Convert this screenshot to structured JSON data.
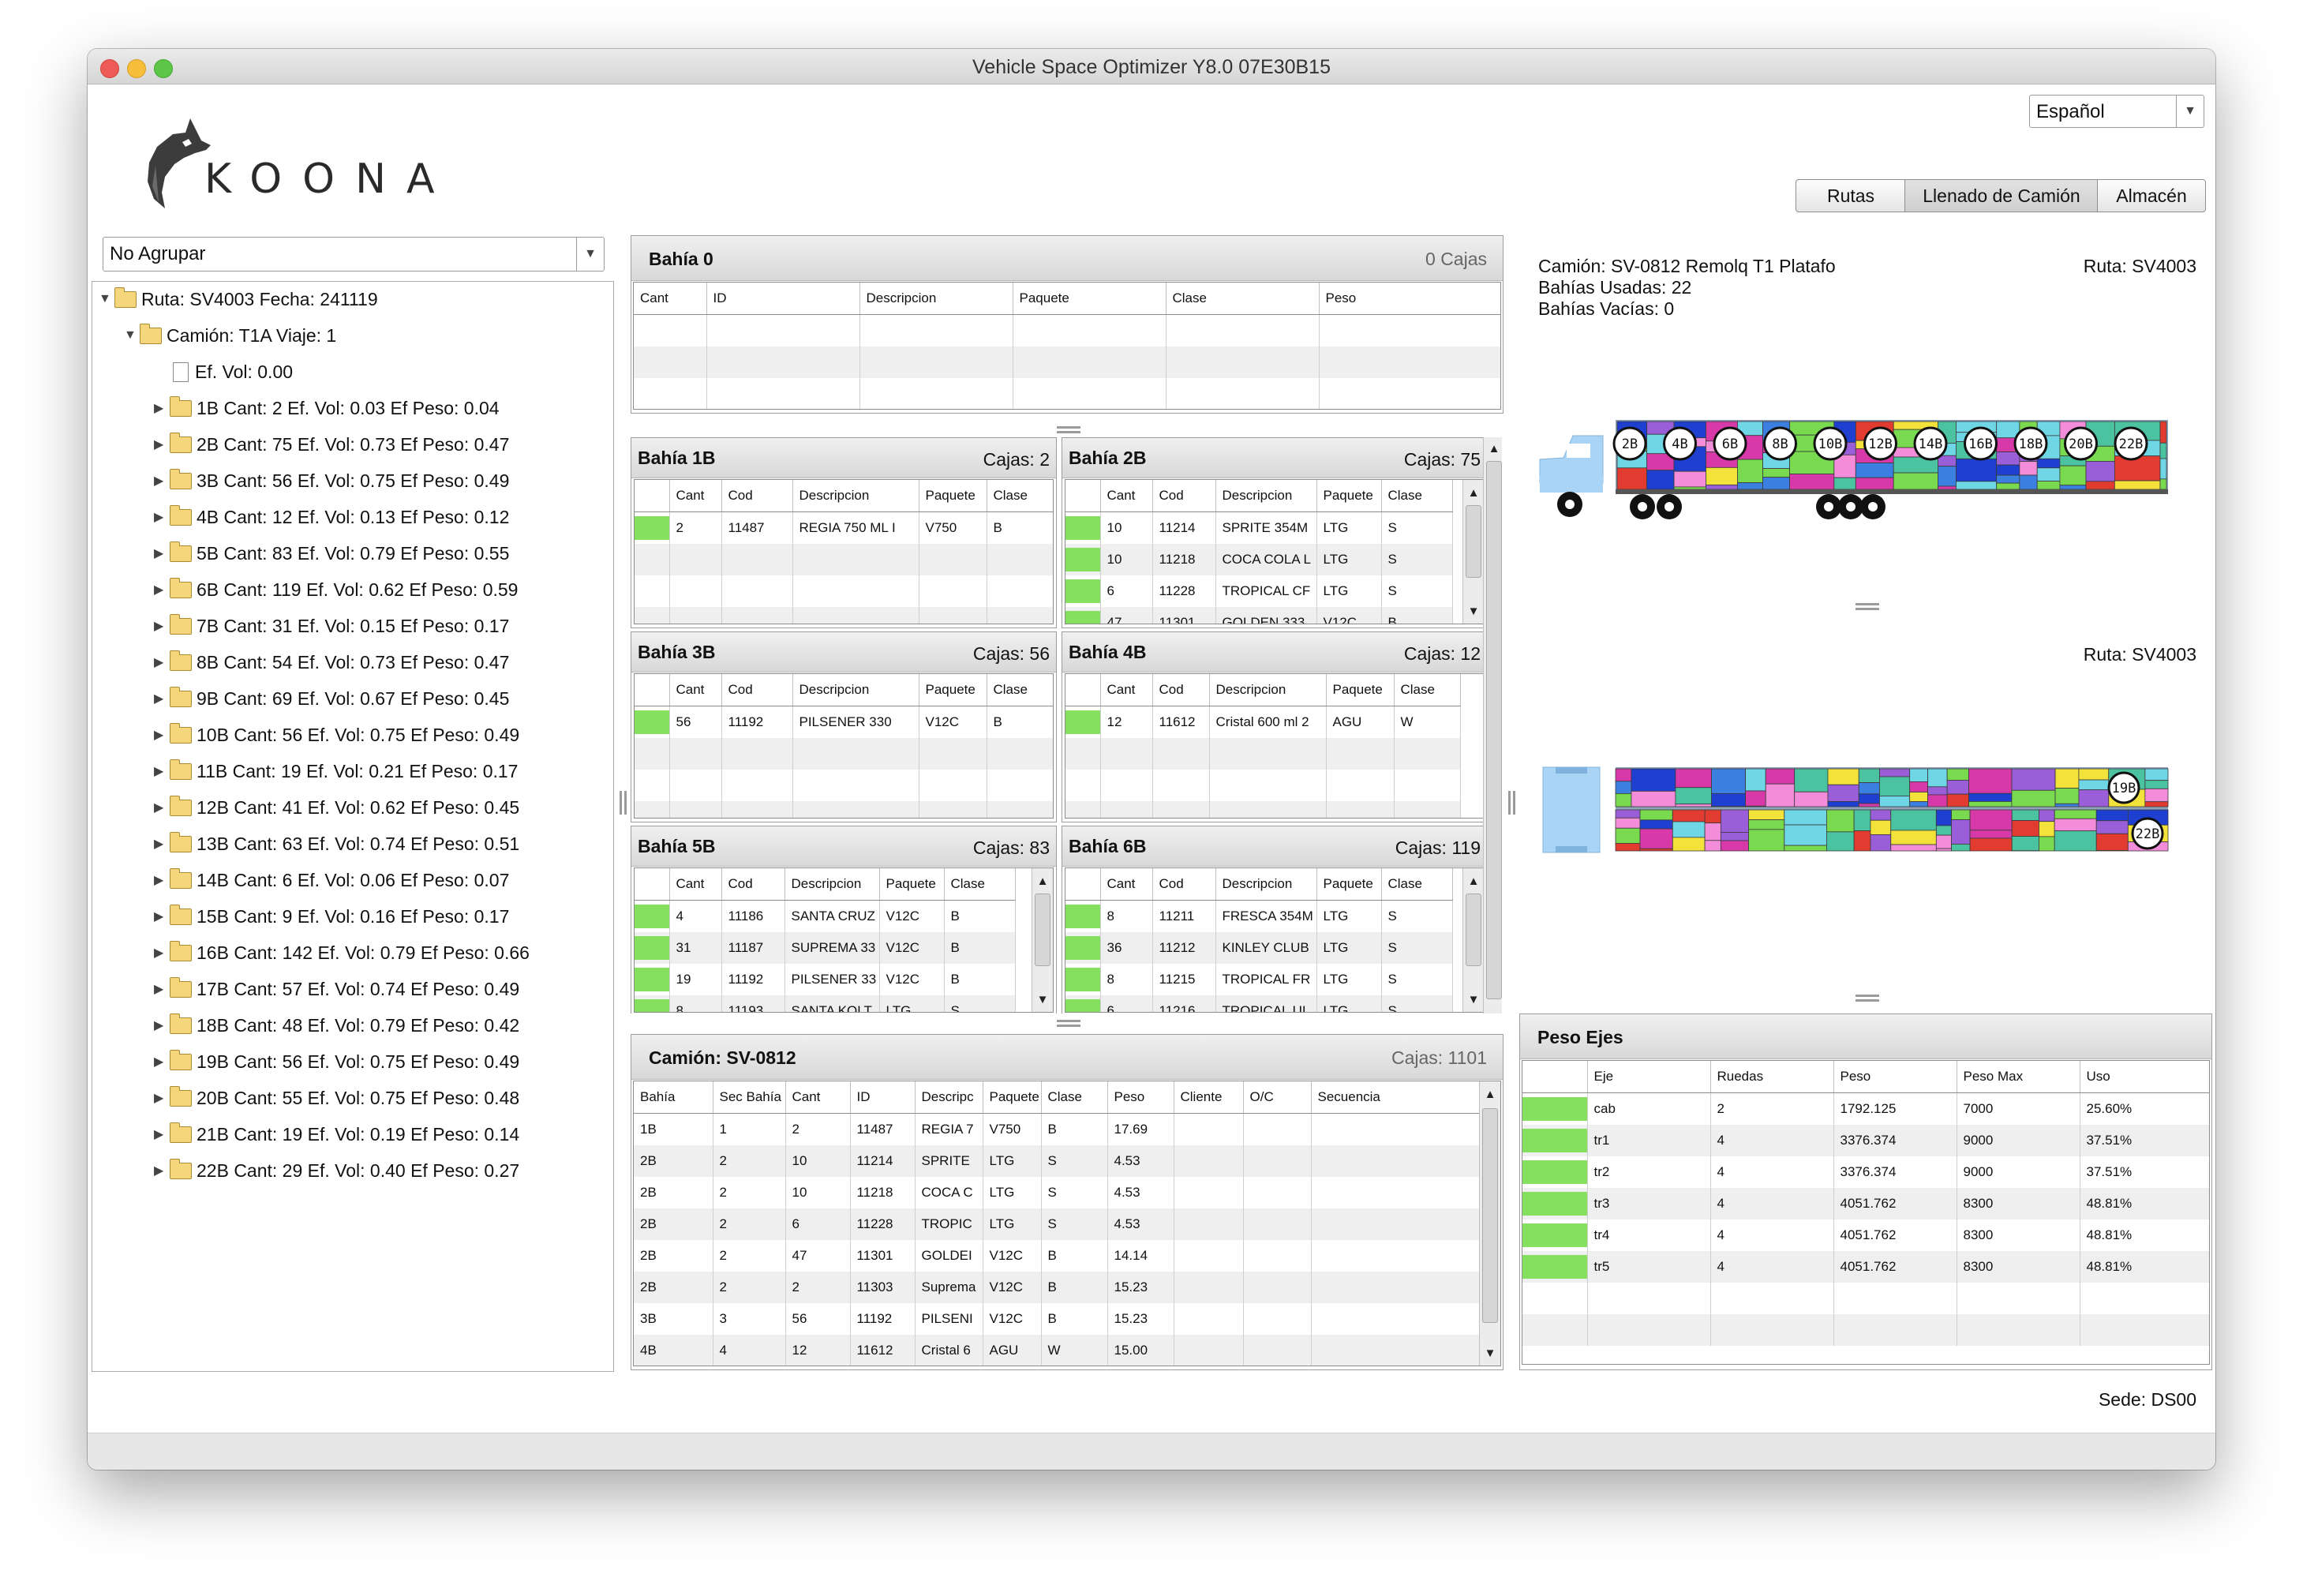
{
  "window": {
    "title": "Vehicle Space Optimizer Y8.0 07E30B15"
  },
  "brand": {
    "logo_text": "KOONA"
  },
  "language": {
    "selected": "Español"
  },
  "nav": {
    "tabs": [
      {
        "label": "Rutas"
      },
      {
        "label": "Llenado de Camión"
      },
      {
        "label": "Almacén"
      }
    ],
    "selected": "Llenado de Camión"
  },
  "grouping": {
    "selected": "No Agrupar"
  },
  "tree": {
    "route": "Ruta: SV4003 Fecha: 241119",
    "truck": "Camión: T1A Viaje: 1",
    "vol": "Ef. Vol: 0.00",
    "bays": [
      "1B Cant: 2 Ef. Vol: 0.03 Ef Peso: 0.04",
      "2B Cant: 75 Ef. Vol: 0.73 Ef Peso: 0.47",
      "3B Cant: 56 Ef. Vol: 0.75 Ef Peso: 0.49",
      "4B Cant: 12 Ef. Vol: 0.13 Ef Peso: 0.12",
      "5B Cant: 83 Ef. Vol: 0.79 Ef Peso: 0.55",
      "6B Cant: 119 Ef. Vol: 0.62 Ef Peso: 0.59",
      "7B Cant: 31 Ef. Vol: 0.15 Ef Peso: 0.17",
      "8B Cant: 54 Ef. Vol: 0.73 Ef Peso: 0.47",
      "9B Cant: 69 Ef. Vol: 0.67 Ef Peso: 0.45",
      "10B Cant: 56 Ef. Vol: 0.75 Ef Peso: 0.49",
      "11B Cant: 19 Ef. Vol: 0.21 Ef Peso: 0.17",
      "12B Cant: 41 Ef. Vol: 0.62 Ef Peso: 0.45",
      "13B Cant: 63 Ef. Vol: 0.74 Ef Peso: 0.51",
      "14B Cant: 6 Ef. Vol: 0.06 Ef Peso: 0.07",
      "15B Cant: 9 Ef. Vol: 0.16 Ef Peso: 0.17",
      "16B Cant: 142 Ef. Vol: 0.79 Ef Peso: 0.66",
      "17B Cant: 57 Ef. Vol: 0.74 Ef Peso: 0.49",
      "18B Cant: 48 Ef. Vol: 0.79 Ef Peso: 0.42",
      "19B Cant: 56 Ef. Vol: 0.75 Ef Peso: 0.49",
      "20B Cant: 55 Ef. Vol: 0.75 Ef Peso: 0.48",
      "21B Cant: 19 Ef. Vol: 0.19 Ef Peso: 0.14",
      "22B Cant: 29 Ef. Vol: 0.40 Ef Peso: 0.27"
    ]
  },
  "bay0": {
    "title": "Bahía 0",
    "count": "0 Cajas",
    "columns": [
      "Cant",
      "ID",
      "Descripcion",
      "Paquete",
      "Clase",
      "Peso"
    ]
  },
  "bay_cols": [
    "",
    "Cant",
    "Cod",
    "Descripcion",
    "Paquete",
    "Clase"
  ],
  "bays": [
    {
      "title": "Bahía 1B",
      "count": "Cajas: 2",
      "rows": [
        [
          "2",
          "11487",
          "REGIA 750 ML I",
          "V750",
          "B"
        ]
      ]
    },
    {
      "title": "Bahía 2B",
      "count": "Cajas: 75",
      "rows": [
        [
          "10",
          "11214",
          "SPRITE 354M",
          "LTG",
          "S"
        ],
        [
          "10",
          "11218",
          "COCA COLA L",
          "LTG",
          "S"
        ],
        [
          "6",
          "11228",
          "TROPICAL CF",
          "LTG",
          "S"
        ],
        [
          "47",
          "11301",
          "GOLDEN 333",
          "V12C",
          "B"
        ]
      ]
    },
    {
      "title": "Bahía 3B",
      "count": "Cajas: 56",
      "rows": [
        [
          "56",
          "11192",
          "PILSENER 330",
          "V12C",
          "B"
        ]
      ]
    },
    {
      "title": "Bahía 4B",
      "count": "Cajas: 12",
      "rows": [
        [
          "12",
          "11612",
          "Cristal 600 ml 2",
          "AGU",
          "W"
        ]
      ]
    },
    {
      "title": "Bahía 5B",
      "count": "Cajas: 83",
      "rows": [
        [
          "4",
          "11186",
          "SANTA CRUZ",
          "V12C",
          "B"
        ],
        [
          "31",
          "11187",
          "SUPREMA 33",
          "V12C",
          "B"
        ],
        [
          "19",
          "11192",
          "PILSENER 33",
          "V12C",
          "B"
        ],
        [
          "8",
          "11193",
          "SANTA KOLT",
          "LTG",
          "S"
        ]
      ]
    },
    {
      "title": "Bahía 6B",
      "count": "Cajas: 119",
      "rows": [
        [
          "8",
          "11211",
          "FRESCA 354M",
          "LTG",
          "S"
        ],
        [
          "36",
          "11212",
          "KINLEY CLUB",
          "LTG",
          "S"
        ],
        [
          "8",
          "11215",
          "TROPICAL FR",
          "LTG",
          "S"
        ],
        [
          "6",
          "11216",
          "TROPICAL UI",
          "LTG",
          "S"
        ]
      ]
    }
  ],
  "truck_panel": {
    "title": "Camión: SV-0812",
    "count": "Cajas: 1101",
    "columns": [
      "Bahía",
      "Sec Bahía",
      "Cant",
      "ID",
      "Descripc",
      "Paquete",
      "Clase",
      "Peso",
      "Cliente",
      "O/C",
      "Secuencia"
    ],
    "rows": [
      [
        "1B",
        "1",
        "2",
        "11487",
        "REGIA 7",
        "V750",
        "B",
        "17.69"
      ],
      [
        "2B",
        "2",
        "10",
        "11214",
        "SPRITE",
        "LTG",
        "S",
        "4.53"
      ],
      [
        "2B",
        "2",
        "10",
        "11218",
        "COCA C",
        "LTG",
        "S",
        "4.53"
      ],
      [
        "2B",
        "2",
        "6",
        "11228",
        "TROPIC",
        "LTG",
        "S",
        "4.53"
      ],
      [
        "2B",
        "2",
        "47",
        "11301",
        "GOLDEI",
        "V12C",
        "B",
        "14.14"
      ],
      [
        "2B",
        "2",
        "2",
        "11303",
        "Suprema",
        "V12C",
        "B",
        "15.23"
      ],
      [
        "3B",
        "3",
        "56",
        "11192",
        "PILSENI",
        "V12C",
        "B",
        "15.23"
      ],
      [
        "4B",
        "4",
        "12",
        "11612",
        "Cristal 6",
        "AGU",
        "W",
        "15.00"
      ]
    ]
  },
  "truck_info": {
    "line1": "Camión: SV-0812 Remolq T1 Platafo",
    "line2": "Bahías Usadas: 22",
    "line3": "Bahías Vacías: 0",
    "route": "Ruta: SV4003",
    "route2": "Ruta: SV4003"
  },
  "side_view": {
    "labels": [
      "2B",
      "4B",
      "6B",
      "8B",
      "10B",
      "12B",
      "14B",
      "16B",
      "18B",
      "20B",
      "22B"
    ]
  },
  "top_view": {
    "labels": [
      "19B",
      "22B"
    ]
  },
  "axles": {
    "title": "Peso Ejes",
    "columns": [
      "",
      "Eje",
      "Ruedas",
      "Peso",
      "Peso Max",
      "Uso"
    ],
    "rows": [
      [
        "cab",
        "2",
        "1792.125",
        "7000",
        "25.60%"
      ],
      [
        "tr1",
        "4",
        "3376.374",
        "9000",
        "37.51%"
      ],
      [
        "tr2",
        "4",
        "3376.374",
        "9000",
        "37.51%"
      ],
      [
        "tr3",
        "4",
        "4051.762",
        "8300",
        "48.81%"
      ],
      [
        "tr4",
        "4",
        "4051.762",
        "8300",
        "48.81%"
      ],
      [
        "tr5",
        "4",
        "4051.762",
        "8300",
        "48.81%"
      ]
    ]
  },
  "footer": {
    "sede": "Sede: DS00"
  },
  "colors": {
    "ok_green": "#86e060",
    "truck_blue": "#a9d4f5"
  }
}
